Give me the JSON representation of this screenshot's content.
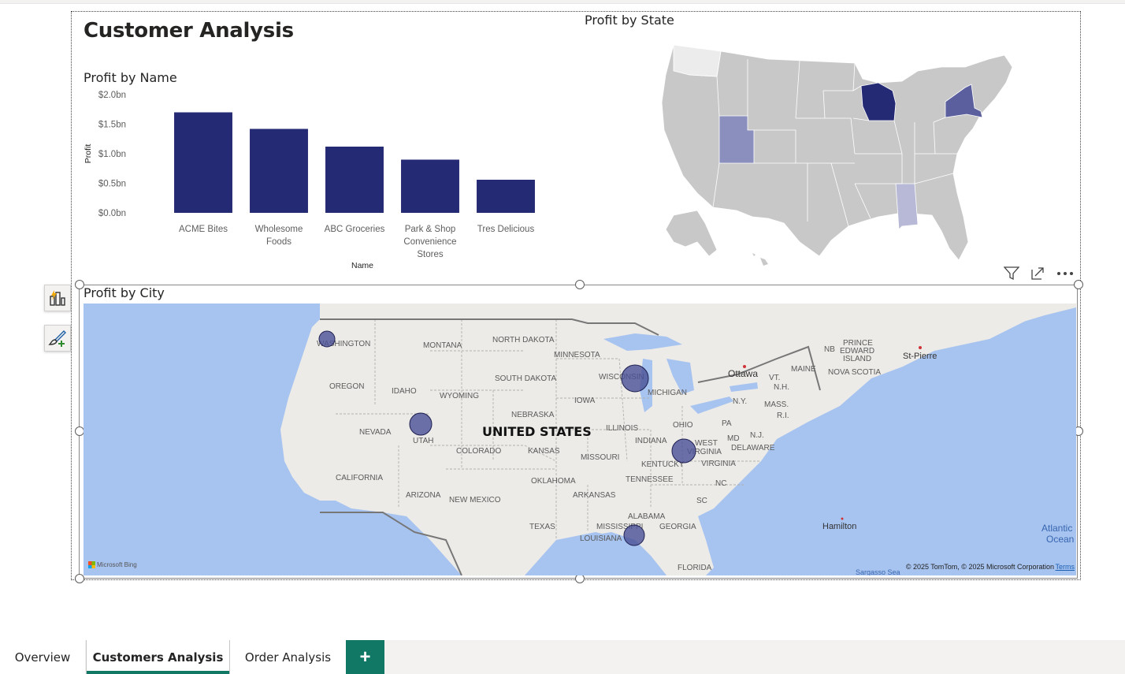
{
  "report": {
    "title": "Customer Analysis"
  },
  "bar_visual": {
    "title": "Profit by Name"
  },
  "state_visual": {
    "title": "Profit by State"
  },
  "city_visual": {
    "title": "Profit by City",
    "country_label": "UNITED STATES",
    "labels": {
      "washington": "WASHINGTON",
      "oregon": "OREGON",
      "idaho": "IDAHO",
      "montana": "MONTANA",
      "wyoming": "WYOMING",
      "north_dakota": "NORTH DAKOTA",
      "south_dakota": "SOUTH DAKOTA",
      "nebraska": "NEBRASKA",
      "minnesota": "MINNESOTA",
      "wisconsin": "WISCONSIN",
      "michigan": "MICHIGAN",
      "iowa": "IOWA",
      "illinois": "ILLINOIS",
      "indiana": "INDIANA",
      "ohio": "OHIO",
      "nevada": "NEVADA",
      "utah": "UTAH",
      "colorado": "COLORADO",
      "kansas": "KANSAS",
      "missouri": "MISSOURI",
      "kentucky": "KENTUCKY",
      "west": "WEST",
      "virginia_wv": "VIRGINIA",
      "virginia": "VIRGINIA",
      "california": "CALIFORNIA",
      "arizona": "ARIZONA",
      "new_mexico": "NEW MEXICO",
      "oklahoma": "OKLAHOMA",
      "arkansas": "ARKANSAS",
      "tennessee": "TENNESSEE",
      "nc": "NC",
      "sc": "SC",
      "texas": "TEXAS",
      "mississippi": "MISSISSIPPI",
      "alabama": "ALABAMA",
      "georgia": "GEORGIA",
      "louisiana": "LOUISIANA",
      "florida": "FLORIDA",
      "pa": "PA",
      "ny": "N.Y.",
      "md": "MD",
      "nj": "N.J.",
      "delaware": "DELAWARE",
      "mass": "MASS.",
      "ri": "R.I.",
      "vt": "VT.",
      "nh": "N.H.",
      "maine": "MAINE",
      "nb": "NB",
      "pei": "PRINCE",
      "pei2": "EDWARD",
      "pei3": "ISLAND",
      "nova_scotia": "NOVA SCOTIA",
      "ottawa": "Ottawa",
      "st_pierre": "St-Pierre",
      "hamilton": "Hamilton",
      "atlantic": "Atlantic",
      "ocean": "Ocean",
      "sargasso": "Sargasso Sea"
    },
    "copyright": "© 2025 TomTom, © 2025 Microsoft Corporation",
    "terms": "Terms",
    "bing": "Microsoft Bing"
  },
  "tabs": [
    {
      "label": "Overview"
    },
    {
      "label": "Customers Analysis",
      "active": true
    },
    {
      "label": "Order Analysis"
    }
  ],
  "add_tab_label": "+",
  "colors": {
    "bar": "#252a74",
    "accent": "#117865",
    "bubble": "#4a5096"
  },
  "chart_data": {
    "type": "bar",
    "categories": [
      "ACME Bites",
      "Wholesome Foods",
      "ABC Groceries",
      "Park & Shop Convenience Stores",
      "Tres Delicious"
    ],
    "category_lines": [
      [
        "ACME Bites"
      ],
      [
        "Wholesome",
        "Foods"
      ],
      [
        "ABC Groceries"
      ],
      [
        "Park & Shop",
        "Convenience",
        "Stores"
      ],
      [
        "Tres Delicious"
      ]
    ],
    "values": [
      1.7,
      1.42,
      1.12,
      0.9,
      0.56
    ],
    "ylim": [
      0,
      2.0
    ],
    "yticks": [
      0,
      0.5,
      1.0,
      1.5,
      2.0
    ],
    "ytick_labels": [
      "$0.0bn",
      "$0.5bn",
      "$1.0bn",
      "$1.5bn",
      "$2.0bn"
    ],
    "xlabel": "Name",
    "ylabel": "Profit",
    "grid": false
  }
}
